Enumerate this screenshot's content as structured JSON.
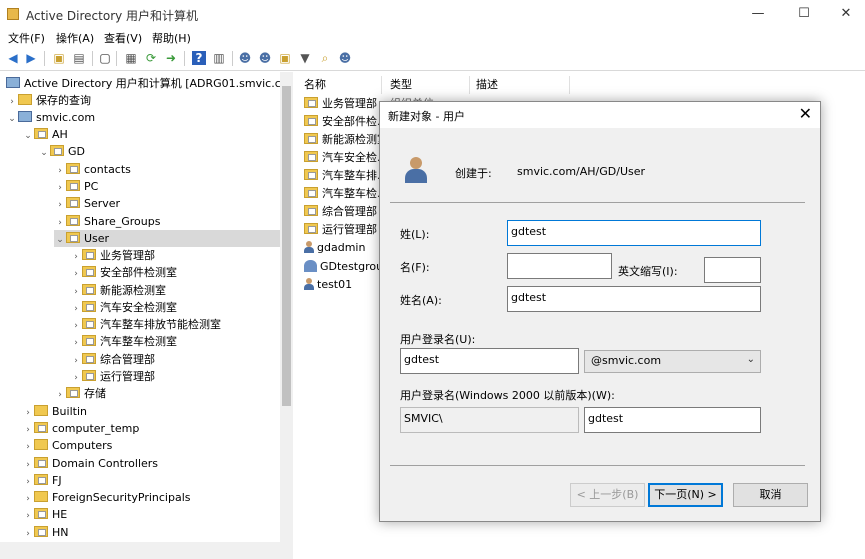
{
  "window": {
    "title": "Active Directory 用户和计算机",
    "min": "—",
    "max": "☐",
    "close": "✕"
  },
  "menu": [
    "文件(F)",
    "操作(A)",
    "查看(V)",
    "帮助(H)"
  ],
  "tree": {
    "root": "Active Directory 用户和计算机 [ADRG01.smvic.com]",
    "saved_queries": "保存的查询",
    "domain": "smvic.com",
    "ah": "AH",
    "gd": "GD",
    "gd_children": [
      "contacts",
      "PC",
      "Server",
      "Share_Groups"
    ],
    "user": "User",
    "user_children": [
      "业务管理部",
      "安全部件检测室",
      "新能源检测室",
      "汽车安全检测室",
      "汽车整车排放节能检测室",
      "汽车整车检测室",
      "综合管理部",
      "运行管理部"
    ],
    "storage": "存储",
    "domain_children": [
      "Builtin",
      "computer_temp",
      "Computers",
      "Domain Controllers",
      "FJ",
      "ForeignSecurityPrincipals",
      "HE",
      "HN"
    ]
  },
  "list": {
    "columns": [
      "名称",
      "类型",
      "描述"
    ],
    "rows": [
      {
        "name": "业务管理部",
        "type": "组织单位"
      },
      {
        "name": "安全部件检...",
        "type": ""
      },
      {
        "name": "新能源检测室",
        "type": ""
      },
      {
        "name": "汽车安全检...",
        "type": ""
      },
      {
        "name": "汽车整车排...",
        "type": ""
      },
      {
        "name": "汽车整车检...",
        "type": ""
      },
      {
        "name": "综合管理部",
        "type": ""
      },
      {
        "name": "运行管理部",
        "type": ""
      },
      {
        "name": "gdadmin",
        "type": ""
      },
      {
        "name": "GDtestgroup",
        "type": ""
      },
      {
        "name": "test01",
        "type": ""
      }
    ]
  },
  "dialog": {
    "title": "新建对象 - 用户",
    "created_in_label": "创建于:",
    "created_in_value": "smvic.com/AH/GD/User",
    "last_name_label": "姓(L):",
    "last_name_value": "gdtest",
    "first_name_label": "名(F):",
    "first_name_value": "",
    "initials_label": "英文缩写(I):",
    "initials_value": "",
    "full_name_label": "姓名(A):",
    "full_name_value": "gdtest",
    "logon_label": "用户登录名(U):",
    "logon_value": "gdtest",
    "upn_suffix": "@smvic.com",
    "logon_pre2000_label": "用户登录名(Windows 2000 以前版本)(W):",
    "domain_prefix": "SMVIC\\",
    "logon_pre2000_value": "gdtest",
    "back_button": "< 上一步(B)",
    "next_button": "下一页(N) >",
    "cancel_button": "取消"
  }
}
